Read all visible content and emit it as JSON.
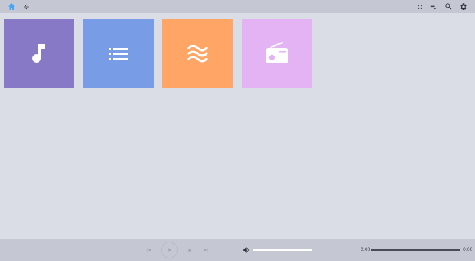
{
  "icons": {
    "home": "home-icon",
    "back": "back-arrow-icon",
    "fullscreen": "fullscreen-icon",
    "queue": "playlist-queue-icon",
    "search": "search-icon",
    "settings": "gear-icon"
  },
  "colors": {
    "topbar_bg": "#c5c8d3",
    "page_bg": "#dadde6",
    "home_accent": "#42a5f5",
    "tile_music": "#8879c7",
    "tile_playlists": "#789ce6",
    "tile_streams": "#ffa566",
    "tile_radio": "#e4b3f4"
  },
  "tiles": [
    {
      "key": "music",
      "icon": "music-note-icon"
    },
    {
      "key": "playlists",
      "icon": "list-icon"
    },
    {
      "key": "streams",
      "icon": "waves-icon"
    },
    {
      "key": "radio",
      "icon": "radio-icon"
    }
  ],
  "player": {
    "current_time": "0:00",
    "total_time": "0:00",
    "volume": 1.0,
    "progress": 1.0
  }
}
